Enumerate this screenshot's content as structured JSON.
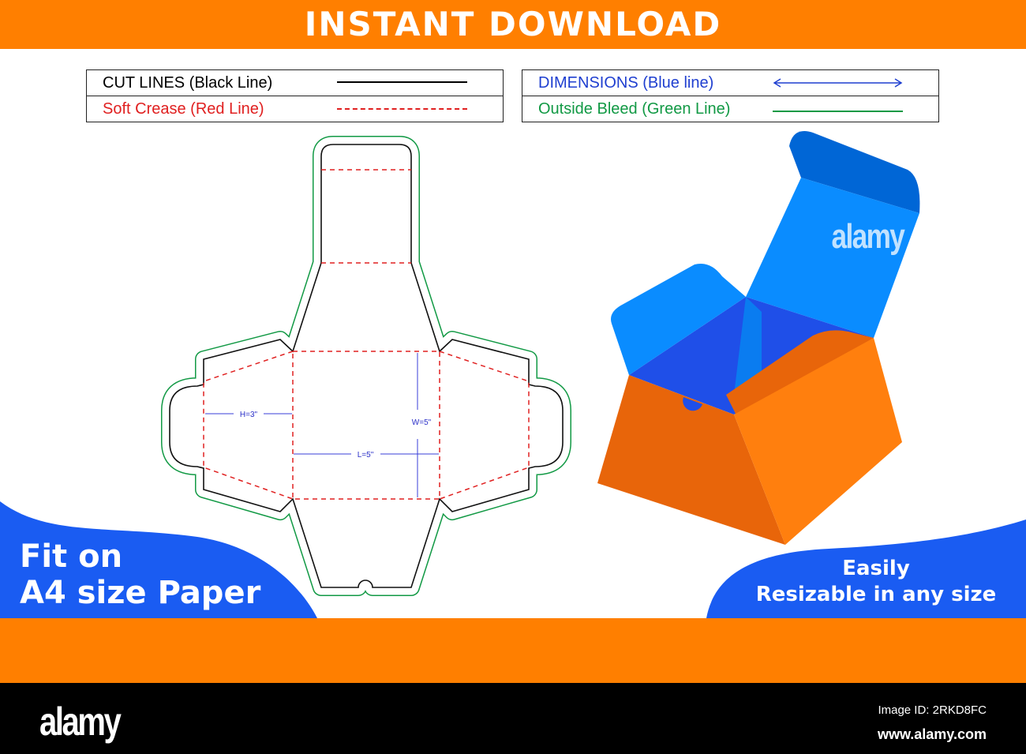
{
  "header": {
    "title": "INSTANT DOWNLOAD"
  },
  "legend_left": [
    {
      "label": "CUT LINES (Black Line)",
      "color": "#000000"
    },
    {
      "label": "Soft Crease (Red Line)",
      "color": "#e02020"
    }
  ],
  "legend_right": [
    {
      "label": "DIMENSIONS (Blue line)",
      "color": "#1f3fd0"
    },
    {
      "label": "Outside Bleed (Green Line)",
      "color": "#119944"
    }
  ],
  "dieline": {
    "height_label": "H=3\"",
    "length_label": "L=5\"",
    "width_label": "W=5\""
  },
  "badge_left": {
    "line1": "Fit on",
    "line2": "A4 size Paper"
  },
  "badge_right": {
    "line1": "Easily",
    "line2": "Resizable in any size"
  },
  "watermark": {
    "logo": "alamy",
    "image_id": "Image ID: 2RKD8FC",
    "url": "www.alamy.com"
  },
  "colors": {
    "orange": "#ff7f00",
    "blue": "#1a5cf2"
  }
}
